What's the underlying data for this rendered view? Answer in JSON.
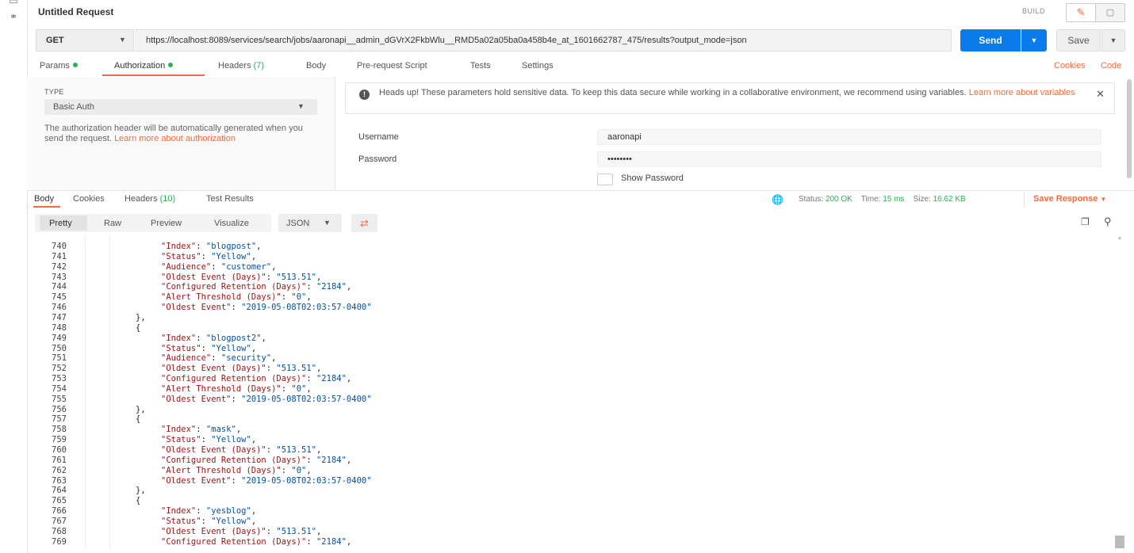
{
  "request": {
    "title": "Untitled Request",
    "build_label": "BUILD",
    "method": "GET",
    "url": "https://localhost:8089/services/search/jobs/aaronapi__admin_dGVrX2FkbWlu__RMD5a02a05ba0a458b4e_at_1601662787_475/results?output_mode=json",
    "send_label": "Send",
    "save_label": "Save"
  },
  "request_tabs": {
    "params": "Params",
    "authorization": "Authorization",
    "headers": "Headers",
    "headers_count": "(7)",
    "body": "Body",
    "prerequest": "Pre-request Script",
    "tests": "Tests",
    "settings": "Settings",
    "cookies": "Cookies",
    "code": "Code"
  },
  "auth": {
    "type_label": "TYPE",
    "type_value": "Basic Auth",
    "help_text": "The authorization header will be automatically generated when you send the request. ",
    "help_link": "Learn more about authorization",
    "warning_text": "Heads up! These parameters hold sensitive data. To keep this data secure while working in a collaborative environment, we recommend using variables. ",
    "warning_link": "Learn more about variables",
    "username_label": "Username",
    "username_value": "aaronapi",
    "password_label": "Password",
    "password_value": "••••••••",
    "show_password_label": "Show Password"
  },
  "response_tabs": {
    "body": "Body",
    "cookies": "Cookies",
    "headers": "Headers",
    "headers_count": "(10)",
    "test_results": "Test Results"
  },
  "response_status": {
    "status_label": "Status:",
    "status_value": "200 OK",
    "time_label": "Time:",
    "time_value": "15 ms",
    "size_label": "Size:",
    "size_value": "16.62 KB",
    "save_response": "Save Response"
  },
  "format_bar": {
    "pretty": "Pretty",
    "raw": "Raw",
    "preview": "Preview",
    "visualize": "Visualize",
    "language": "JSON"
  },
  "code_lines": [
    {
      "n": "740",
      "indent": 2,
      "k": "Index",
      "v": "blogpost",
      "c": true
    },
    {
      "n": "741",
      "indent": 2,
      "k": "Status",
      "v": "Yellow",
      "c": true
    },
    {
      "n": "742",
      "indent": 2,
      "k": "Audience",
      "v": "customer",
      "c": true
    },
    {
      "n": "743",
      "indent": 2,
      "k": "Oldest Event (Days)",
      "v": "513.51",
      "c": true
    },
    {
      "n": "744",
      "indent": 2,
      "k": "Configured Retention (Days)",
      "v": "2184",
      "c": true
    },
    {
      "n": "745",
      "indent": 2,
      "k": "Alert Threshold (Days)",
      "v": "0",
      "c": true
    },
    {
      "n": "746",
      "indent": 2,
      "k": "Oldest Event",
      "v": "2019-05-08T02:03:57-0400",
      "c": false
    },
    {
      "n": "747",
      "indent": 1,
      "p": "},"
    },
    {
      "n": "748",
      "indent": 1,
      "p": "{"
    },
    {
      "n": "749",
      "indent": 2,
      "k": "Index",
      "v": "blogpost2",
      "c": true
    },
    {
      "n": "750",
      "indent": 2,
      "k": "Status",
      "v": "Yellow",
      "c": true
    },
    {
      "n": "751",
      "indent": 2,
      "k": "Audience",
      "v": "security",
      "c": true
    },
    {
      "n": "752",
      "indent": 2,
      "k": "Oldest Event (Days)",
      "v": "513.51",
      "c": true
    },
    {
      "n": "753",
      "indent": 2,
      "k": "Configured Retention (Days)",
      "v": "2184",
      "c": true
    },
    {
      "n": "754",
      "indent": 2,
      "k": "Alert Threshold (Days)",
      "v": "0",
      "c": true
    },
    {
      "n": "755",
      "indent": 2,
      "k": "Oldest Event",
      "v": "2019-05-08T02:03:57-0400",
      "c": false
    },
    {
      "n": "756",
      "indent": 1,
      "p": "},"
    },
    {
      "n": "757",
      "indent": 1,
      "p": "{"
    },
    {
      "n": "758",
      "indent": 2,
      "k": "Index",
      "v": "mask",
      "c": true
    },
    {
      "n": "759",
      "indent": 2,
      "k": "Status",
      "v": "Yellow",
      "c": true
    },
    {
      "n": "760",
      "indent": 2,
      "k": "Oldest Event (Days)",
      "v": "513.51",
      "c": true
    },
    {
      "n": "761",
      "indent": 2,
      "k": "Configured Retention (Days)",
      "v": "2184",
      "c": true
    },
    {
      "n": "762",
      "indent": 2,
      "k": "Alert Threshold (Days)",
      "v": "0",
      "c": true
    },
    {
      "n": "763",
      "indent": 2,
      "k": "Oldest Event",
      "v": "2019-05-08T02:03:57-0400",
      "c": false
    },
    {
      "n": "764",
      "indent": 1,
      "p": "},"
    },
    {
      "n": "765",
      "indent": 1,
      "p": "{"
    },
    {
      "n": "766",
      "indent": 2,
      "k": "Index",
      "v": "yesblog",
      "c": true
    },
    {
      "n": "767",
      "indent": 2,
      "k": "Status",
      "v": "Yellow",
      "c": true
    },
    {
      "n": "768",
      "indent": 2,
      "k": "Oldest Event (Days)",
      "v": "513.51",
      "c": true
    },
    {
      "n": "769",
      "indent": 2,
      "k": "Configured Retention (Days)",
      "v": "2184",
      "c": true
    }
  ],
  "colors": {
    "accent": "#f26b3a",
    "send_blue": "#097bed",
    "status_green": "#2ab24e",
    "json_key": "#a31515",
    "json_string": "#0451a5"
  },
  "icons": [
    "pencil-icon",
    "comment-icon",
    "caret-down-icon",
    "info-icon",
    "close-icon",
    "globe-icon",
    "copy-icon",
    "search-icon",
    "wrap-lines-icon"
  ]
}
